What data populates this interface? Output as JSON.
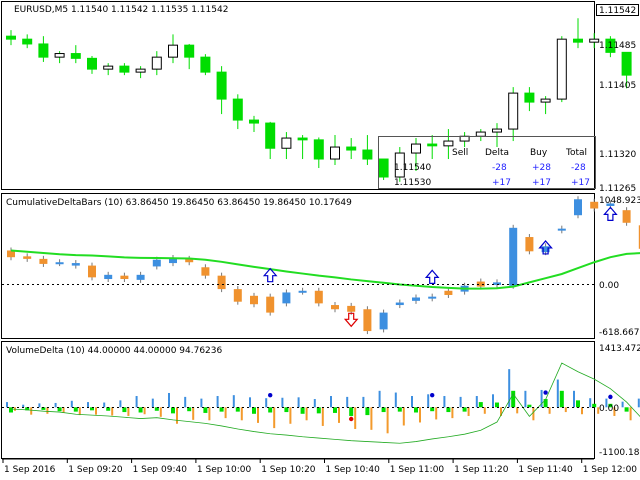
{
  "window": {
    "title": "EURUSD,M5  1.11540 1.11542 1.11535 1.11542"
  },
  "panes": {
    "price": {
      "price_levels": [
        "1.11542",
        "1.11485",
        "1.11405",
        "1.11320",
        "1.11265"
      ],
      "current_price": "1.11542"
    },
    "cdb": {
      "title": "CumulativeDeltaBars (10) 63.86450 19.86450 63.86450 19.86450 10.17649",
      "levels": [
        "1048.923",
        "0.00",
        "-618.6673"
      ]
    },
    "vd": {
      "title": "VolumeDelta (10) 44.00000 44.00000 94.76236",
      "levels": [
        "1413.472",
        "0.00",
        "-1100.186"
      ]
    }
  },
  "delta_table": {
    "headers": [
      "Sell",
      "Delta",
      "Buy",
      "Total"
    ],
    "rows": [
      {
        "price": "1.11540",
        "sell": "",
        "delta": "-28",
        "buy": "+28",
        "total": "-28"
      },
      {
        "price": "1.11530",
        "sell": "",
        "delta": "+17",
        "buy": "+17",
        "total": "+17"
      }
    ]
  },
  "time_axis": [
    "1 Sep 2016",
    "1 Sep 09:20",
    "1 Sep 09:40",
    "1 Sep 10:00",
    "1 Sep 10:20",
    "1 Sep 10:40",
    "1 Sep 11:00",
    "1 Sep 11:20",
    "1 Sep 11:40",
    "1 Sep 12:00"
  ],
  "colors": {
    "bull_border": "#000000",
    "wick": "#00dd00",
    "ma_line": "#22dd22",
    "bar_orange": "#f0922e",
    "bar_blue": "#3d8fe0",
    "up_arrow": "#0000cc",
    "down_arrow": "#dd0000",
    "vd_green": "#00dd00",
    "vd_orange": "#f39a2c",
    "vd_blue": "#3d8fe0",
    "table_delta_neg": "#2222ff"
  },
  "chart_data": [
    {
      "type": "candlestick",
      "symbol": "EURUSD",
      "timeframe": "M5",
      "ylim": [
        1.11255,
        1.11552
      ],
      "candles": [
        {
          "o": 1.11505,
          "h": 1.11515,
          "l": 1.1149,
          "c": 1.115
        },
        {
          "o": 1.115,
          "h": 1.11508,
          "l": 1.11485,
          "c": 1.11492
        },
        {
          "o": 1.11492,
          "h": 1.11505,
          "l": 1.11462,
          "c": 1.1147
        },
        {
          "o": 1.1147,
          "h": 1.1148,
          "l": 1.1146,
          "c": 1.11476
        },
        {
          "o": 1.11476,
          "h": 1.1149,
          "l": 1.1146,
          "c": 1.11468
        },
        {
          "o": 1.11468,
          "h": 1.11472,
          "l": 1.11442,
          "c": 1.1145
        },
        {
          "o": 1.1145,
          "h": 1.1146,
          "l": 1.1144,
          "c": 1.11455
        },
        {
          "o": 1.11455,
          "h": 1.1146,
          "l": 1.1144,
          "c": 1.11445
        },
        {
          "o": 1.11445,
          "h": 1.11455,
          "l": 1.11435,
          "c": 1.1145
        },
        {
          "o": 1.1145,
          "h": 1.1148,
          "l": 1.1144,
          "c": 1.1147
        },
        {
          "o": 1.1147,
          "h": 1.11508,
          "l": 1.1146,
          "c": 1.1149
        },
        {
          "o": 1.1149,
          "h": 1.11492,
          "l": 1.1145,
          "c": 1.1147
        },
        {
          "o": 1.1147,
          "h": 1.11475,
          "l": 1.1144,
          "c": 1.11445
        },
        {
          "o": 1.11445,
          "h": 1.11455,
          "l": 1.11375,
          "c": 1.114
        },
        {
          "o": 1.114,
          "h": 1.11408,
          "l": 1.1135,
          "c": 1.11365
        },
        {
          "o": 1.11365,
          "h": 1.11372,
          "l": 1.11345,
          "c": 1.1136
        },
        {
          "o": 1.1136,
          "h": 1.11362,
          "l": 1.113,
          "c": 1.11318
        },
        {
          "o": 1.11318,
          "h": 1.11345,
          "l": 1.113,
          "c": 1.11335
        },
        {
          "o": 1.11335,
          "h": 1.1134,
          "l": 1.113,
          "c": 1.11332
        },
        {
          "o": 1.11332,
          "h": 1.11336,
          "l": 1.11285,
          "c": 1.113
        },
        {
          "o": 1.113,
          "h": 1.1134,
          "l": 1.1129,
          "c": 1.1132
        },
        {
          "o": 1.1132,
          "h": 1.11335,
          "l": 1.113,
          "c": 1.11315
        },
        {
          "o": 1.11315,
          "h": 1.1134,
          "l": 1.1129,
          "c": 1.113
        },
        {
          "o": 1.113,
          "h": 1.1129,
          "l": 1.11265,
          "c": 1.1127
        },
        {
          "o": 1.1127,
          "h": 1.1132,
          "l": 1.11262,
          "c": 1.1131
        },
        {
          "o": 1.1131,
          "h": 1.11335,
          "l": 1.1128,
          "c": 1.11325
        },
        {
          "o": 1.11325,
          "h": 1.1134,
          "l": 1.113,
          "c": 1.11322
        },
        {
          "o": 1.11322,
          "h": 1.1135,
          "l": 1.113,
          "c": 1.1133
        },
        {
          "o": 1.1133,
          "h": 1.11345,
          "l": 1.1132,
          "c": 1.11338
        },
        {
          "o": 1.11338,
          "h": 1.1135,
          "l": 1.1133,
          "c": 1.11345
        },
        {
          "o": 1.11345,
          "h": 1.1136,
          "l": 1.1132,
          "c": 1.1135
        },
        {
          "o": 1.1135,
          "h": 1.1142,
          "l": 1.1133,
          "c": 1.1141
        },
        {
          "o": 1.1141,
          "h": 1.1142,
          "l": 1.1138,
          "c": 1.11395
        },
        {
          "o": 1.11395,
          "h": 1.11405,
          "l": 1.11375,
          "c": 1.114
        },
        {
          "o": 1.114,
          "h": 1.11505,
          "l": 1.11395,
          "c": 1.115
        },
        {
          "o": 1.115,
          "h": 1.11535,
          "l": 1.11485,
          "c": 1.11495
        },
        {
          "o": 1.11495,
          "h": 1.1151,
          "l": 1.11485,
          "c": 1.115
        },
        {
          "o": 1.115,
          "h": 1.11505,
          "l": 1.1147,
          "c": 1.11478
        },
        {
          "o": 1.11478,
          "h": 1.1146,
          "l": 1.11418,
          "c": 1.1144
        }
      ]
    },
    {
      "type": "bar",
      "name": "CumulativeDeltaBars",
      "ylim": [
        -618.6673,
        1048.923
      ],
      "bars": [
        {
          "o": 400,
          "c": 320,
          "color": "orange"
        },
        {
          "o": 330,
          "c": 300,
          "color": "orange"
        },
        {
          "o": 300,
          "c": 240,
          "color": "orange"
        },
        {
          "o": 260,
          "c": 250,
          "color": "blue"
        },
        {
          "o": 250,
          "c": 220,
          "color": "blue"
        },
        {
          "o": 220,
          "c": 80,
          "color": "orange"
        },
        {
          "o": 110,
          "c": 60,
          "color": "blue"
        },
        {
          "o": 100,
          "c": 60,
          "color": "orange"
        },
        {
          "o": 50,
          "c": 110,
          "color": "blue"
        },
        {
          "o": 210,
          "c": 290,
          "color": "blue"
        },
        {
          "o": 250,
          "c": 310,
          "color": "blue"
        },
        {
          "o": 260,
          "c": 300,
          "color": "orange"
        },
        {
          "o": 200,
          "c": 100,
          "color": "orange"
        },
        {
          "o": 100,
          "c": -60,
          "color": "orange"
        },
        {
          "o": -60,
          "c": -210,
          "color": "orange"
        },
        {
          "o": -140,
          "c": -240,
          "color": "orange"
        },
        {
          "o": -150,
          "c": -340,
          "color": "orange"
        },
        {
          "o": -100,
          "c": -230,
          "color": "blue"
        },
        {
          "o": -80,
          "c": -90,
          "color": "blue"
        },
        {
          "o": -80,
          "c": -230,
          "color": "orange"
        },
        {
          "o": -250,
          "c": -300,
          "color": "orange"
        },
        {
          "o": -260,
          "c": -330,
          "color": "orange"
        },
        {
          "o": -300,
          "c": -560,
          "color": "orange"
        },
        {
          "o": -340,
          "c": -540,
          "color": "blue"
        },
        {
          "o": -220,
          "c": -250,
          "color": "blue"
        },
        {
          "o": -160,
          "c": -200,
          "color": "blue"
        },
        {
          "o": -150,
          "c": -170,
          "color": "blue"
        },
        {
          "o": -80,
          "c": -130,
          "color": "orange"
        },
        {
          "o": -20,
          "c": -90,
          "color": "blue"
        },
        {
          "o": 30,
          "c": -30,
          "color": "orange"
        },
        {
          "o": 20,
          "c": -10,
          "color": "blue"
        },
        {
          "o": -20,
          "c": 670,
          "color": "blue"
        },
        {
          "o": 560,
          "c": 390,
          "color": "orange"
        },
        {
          "o": 450,
          "c": 380,
          "color": "blue"
        },
        {
          "o": 640,
          "c": 660,
          "color": "blue"
        },
        {
          "o": 1010,
          "c": 820,
          "color": "blue"
        },
        {
          "o": 980,
          "c": 900,
          "color": "orange"
        },
        {
          "o": 960,
          "c": 930,
          "color": "blue"
        },
        {
          "o": 880,
          "c": 730,
          "color": "orange"
        },
        {
          "o": 700,
          "c": 420,
          "color": "orange"
        }
      ],
      "ma": [
        400,
        385,
        370,
        355,
        345,
        340,
        330,
        318,
        312,
        310,
        308,
        305,
        290,
        265,
        235,
        205,
        178,
        150,
        125,
        100,
        80,
        55,
        35,
        15,
        -5,
        -20,
        -35,
        -45,
        -55,
        -55,
        -50,
        -30,
        20,
        70,
        120,
        190,
        260,
        320,
        360,
        370
      ],
      "arrows": [
        {
          "i": 16,
          "dir": "up",
          "v": 100
        },
        {
          "i": 21,
          "dir": "down",
          "v": -420
        },
        {
          "i": 26,
          "dir": "up",
          "v": 80
        },
        {
          "i": 33,
          "dir": "up",
          "v": 430
        },
        {
          "i": 37,
          "dir": "up",
          "v": 830
        }
      ]
    },
    {
      "type": "bar",
      "name": "VolumeDelta",
      "ylim": [
        -1100.186,
        1413.472
      ],
      "groups": [
        {
          "b": 120,
          "o": -80,
          "g": -120
        },
        {
          "b": 60,
          "o": -170,
          "g": -70
        },
        {
          "b": 90,
          "o": -150,
          "g": -60
        },
        {
          "b": 100,
          "o": -130,
          "g": -90
        },
        {
          "b": 150,
          "o": -180,
          "g": -100
        },
        {
          "b": 120,
          "o": -170,
          "g": -70
        },
        {
          "b": 110,
          "o": -190,
          "g": -80
        },
        {
          "b": 160,
          "o": -200,
          "g": -110
        },
        {
          "b": 260,
          "o": -160,
          "g": -120
        },
        {
          "b": 200,
          "o": -220,
          "g": -80
        },
        {
          "b": 330,
          "o": -380,
          "g": -140
        },
        {
          "b": 240,
          "o": -290,
          "g": -90
        },
        {
          "b": 200,
          "o": -300,
          "g": -130
        },
        {
          "b": 260,
          "o": -250,
          "g": -100
        },
        {
          "b": 280,
          "o": -300,
          "g": -100
        },
        {
          "b": 230,
          "o": -360,
          "g": -150
        },
        {
          "b": 210,
          "o": -480,
          "g": -120
        },
        {
          "b": 220,
          "o": -380,
          "g": -110
        },
        {
          "b": 230,
          "o": -300,
          "g": -150
        },
        {
          "b": 190,
          "o": -430,
          "g": -140
        },
        {
          "b": 260,
          "o": -360,
          "g": -130
        },
        {
          "b": 240,
          "o": -500,
          "g": -200
        },
        {
          "b": 240,
          "o": -520,
          "g": -180
        },
        {
          "b": 380,
          "o": -600,
          "g": -110
        },
        {
          "b": 340,
          "o": -420,
          "g": -100
        },
        {
          "b": 260,
          "o": -350,
          "g": -120
        },
        {
          "b": 300,
          "o": -280,
          "g": -90
        },
        {
          "b": 260,
          "o": -250,
          "g": -110
        },
        {
          "b": 240,
          "o": -200,
          "g": -100
        },
        {
          "b": 260,
          "o": -150,
          "g": 120
        },
        {
          "b": 300,
          "o": -200,
          "g": 110
        },
        {
          "b": 880,
          "o": -140,
          "g": 380
        },
        {
          "b": 380,
          "o": -300,
          "g": 60
        },
        {
          "b": 400,
          "o": -150,
          "g": 190
        },
        {
          "b": 640,
          "o": -110,
          "g": 380
        },
        {
          "b": 380,
          "o": -160,
          "g": 160
        },
        {
          "b": 210,
          "o": -150,
          "g": 80
        },
        {
          "b": 200,
          "o": -200,
          "g": 80
        },
        {
          "b": 130,
          "o": -300,
          "g": -100
        },
        {
          "b": 200,
          "o": -500,
          "g": -60
        }
      ],
      "cum": [
        -40,
        -60,
        -90,
        -110,
        -160,
        -180,
        -200,
        -230,
        -260,
        -240,
        -290,
        -330,
        -370,
        -430,
        -500,
        -560,
        -610,
        -640,
        -680,
        -710,
        -740,
        -770,
        -790,
        -810,
        -830,
        -790,
        -730,
        -680,
        -620,
        -530,
        -340,
        310,
        -210,
        180,
        1020,
        820,
        650,
        430,
        120,
        -280
      ],
      "markers": [
        {
          "i": 16,
          "dir": "up",
          "v": 280
        },
        {
          "i": 21,
          "dir": "down",
          "v": -270
        },
        {
          "i": 26,
          "dir": "up",
          "v": 280
        },
        {
          "i": 33,
          "dir": "up",
          "v": 340
        },
        {
          "i": 37,
          "dir": "up",
          "v": 240
        }
      ]
    }
  ]
}
